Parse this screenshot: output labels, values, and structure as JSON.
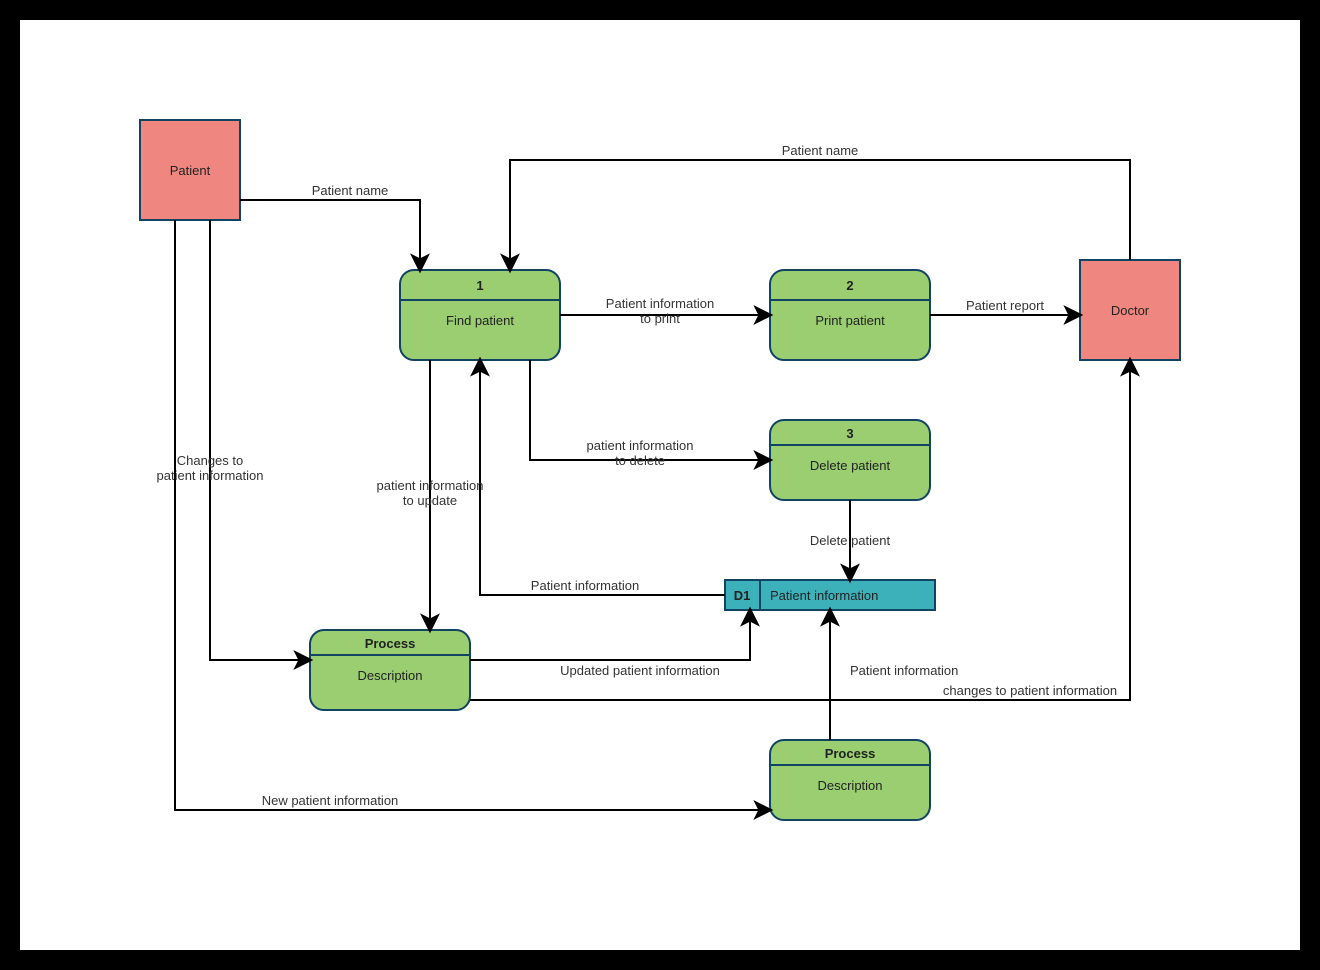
{
  "entities": {
    "patient": "Patient",
    "doctor": "Doctor"
  },
  "processes": {
    "p1": {
      "num": "1",
      "name": "Find patient"
    },
    "p2": {
      "num": "2",
      "name": "Print patient"
    },
    "p3": {
      "num": "3",
      "name": "Delete patient"
    },
    "p4": {
      "num": "Process",
      "name": "Description"
    },
    "p5": {
      "num": "Process",
      "name": "Description"
    }
  },
  "store": {
    "id": "D1",
    "name": "Patient information"
  },
  "flows": {
    "f1": "Patient name",
    "f2": "Patient name",
    "f3": "Patient information to print",
    "f4": "Patient report",
    "f5": "patient information to delete",
    "f6": "Delete patient",
    "f7": "Patient information",
    "f8": "patient information to update",
    "f9": "Updated patient information",
    "f10": "Patient information",
    "f11": "Changes to patient information",
    "f12": "changes to patient information",
    "f13": "New patient information"
  }
}
